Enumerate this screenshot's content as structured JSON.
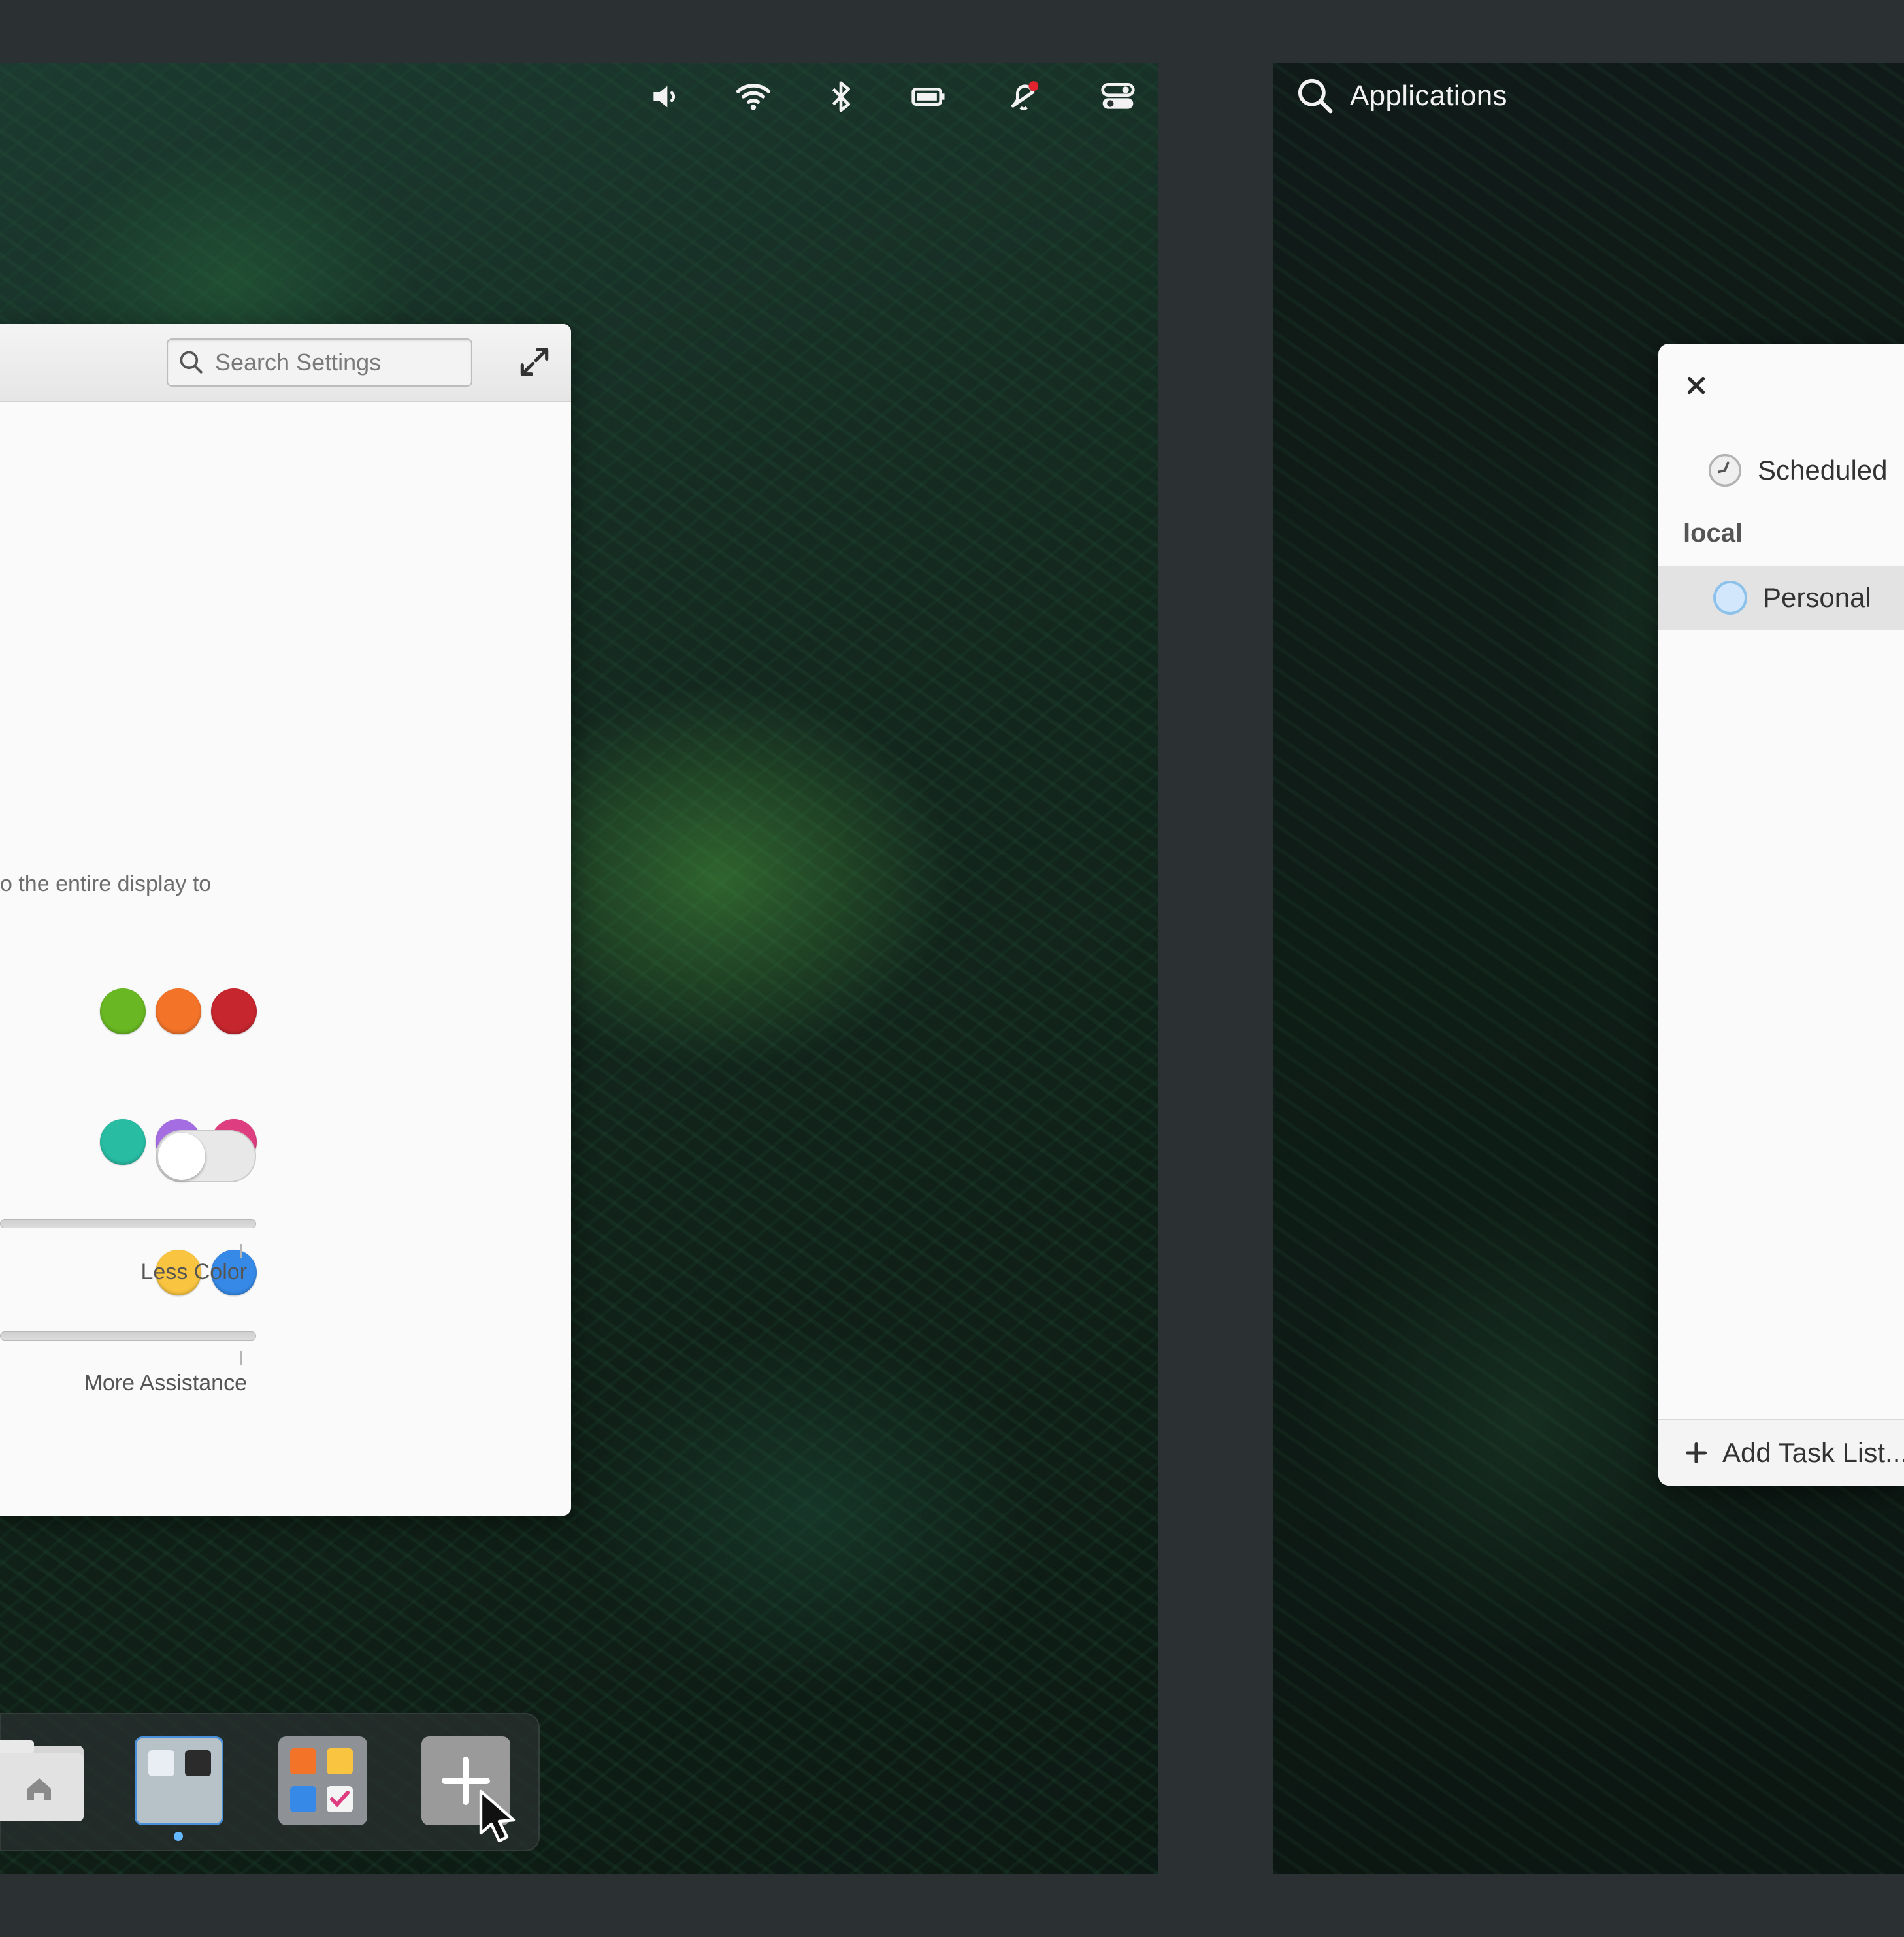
{
  "panel": {
    "indicators": [
      {
        "name": "volume",
        "icon": "speaker-icon"
      },
      {
        "name": "network",
        "icon": "wifi-icon"
      },
      {
        "name": "bluetooth",
        "icon": "bluetooth-icon"
      },
      {
        "name": "power",
        "icon": "battery-icon"
      },
      {
        "name": "notifications",
        "icon": "bell-icon",
        "has_badge": true
      },
      {
        "name": "quick-settings",
        "icon": "toggles-icon"
      }
    ],
    "applications_label": "Applications"
  },
  "settings": {
    "search_placeholder": "Search Settings",
    "description_fragment": "o the entire display to",
    "accent_colors": [
      [
        "#68b723",
        "#f37329",
        "#c6262e"
      ],
      [
        "#28bca3",
        "#a56de2",
        "#de3e80"
      ],
      [
        "#f9c440",
        "#3689e6"
      ]
    ],
    "slider_assistance_label": "More Assistance",
    "toggle_on": false,
    "slider_color_label": "Less Color"
  },
  "dock": {
    "items": [
      "files",
      "workspace-1",
      "workspace-2",
      "add-workspace"
    ],
    "active_indicator_color": "#64baff"
  },
  "tasks": {
    "scheduled_label": "Scheduled",
    "section_label": "local",
    "list_label": "Personal",
    "add_label": "Add Task List..."
  }
}
